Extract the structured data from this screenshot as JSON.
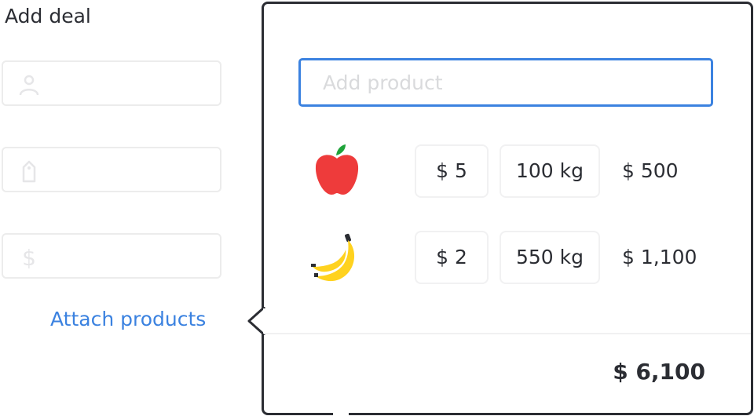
{
  "header": {
    "title": "Add deal"
  },
  "form": {
    "fields": [
      {
        "icon": "person-icon"
      },
      {
        "icon": "tag-icon"
      },
      {
        "icon": "dollar-icon"
      }
    ],
    "attach_label": "Attach products"
  },
  "products_panel": {
    "search": {
      "placeholder": "Add product",
      "value": ""
    },
    "rows": [
      {
        "icon": "apple-icon",
        "price": "$ 5",
        "quantity": "100 kg",
        "subtotal": "$ 500"
      },
      {
        "icon": "banana-icon",
        "price": "$ 2",
        "quantity": "550 kg",
        "subtotal": "$ 1,100"
      }
    ],
    "total": "$ 6,100"
  },
  "colors": {
    "accent": "#3b82e0",
    "text": "#2b2d33",
    "border_light": "#ececec",
    "apple_red": "#ee3b3b",
    "banana_yellow": "#ffd21f"
  }
}
